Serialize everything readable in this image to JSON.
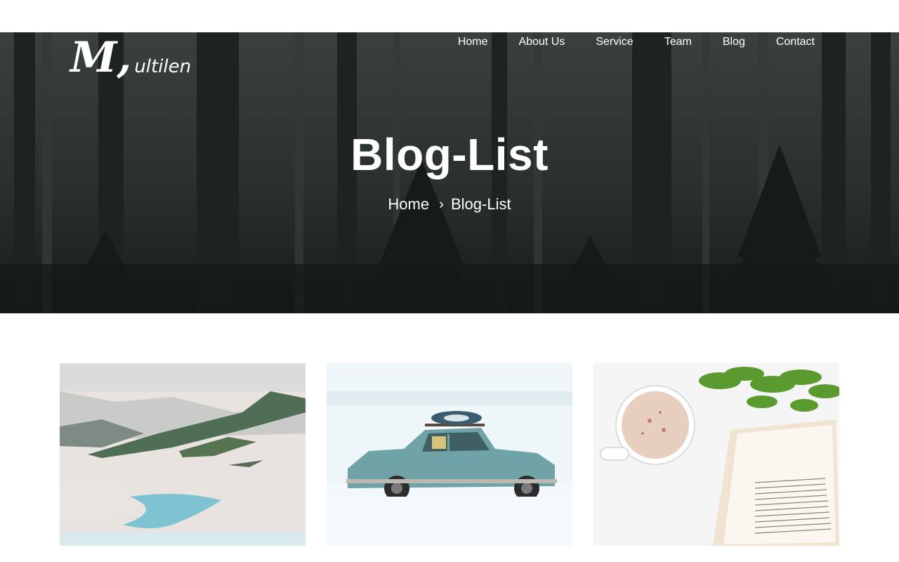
{
  "brand": {
    "logo_initial": "M,",
    "logo_rest": "ultilen",
    "color": "#ffffff"
  },
  "nav": {
    "items": [
      {
        "label": "Home"
      },
      {
        "label": "About Us"
      },
      {
        "label": "Service"
      },
      {
        "label": "Team"
      },
      {
        "label": "Blog"
      },
      {
        "label": "Contact"
      }
    ]
  },
  "hero": {
    "title": "Blog-List",
    "breadcrumb": {
      "home": "Home",
      "separator": "›",
      "current": "Blog-List"
    },
    "background": "misty-forest-image"
  },
  "blog": {
    "cards": [
      {
        "image": "snowy-mountain-river-image"
      },
      {
        "image": "vintage-car-in-snow-image"
      },
      {
        "image": "coffee-cup-and-book-image"
      }
    ]
  }
}
